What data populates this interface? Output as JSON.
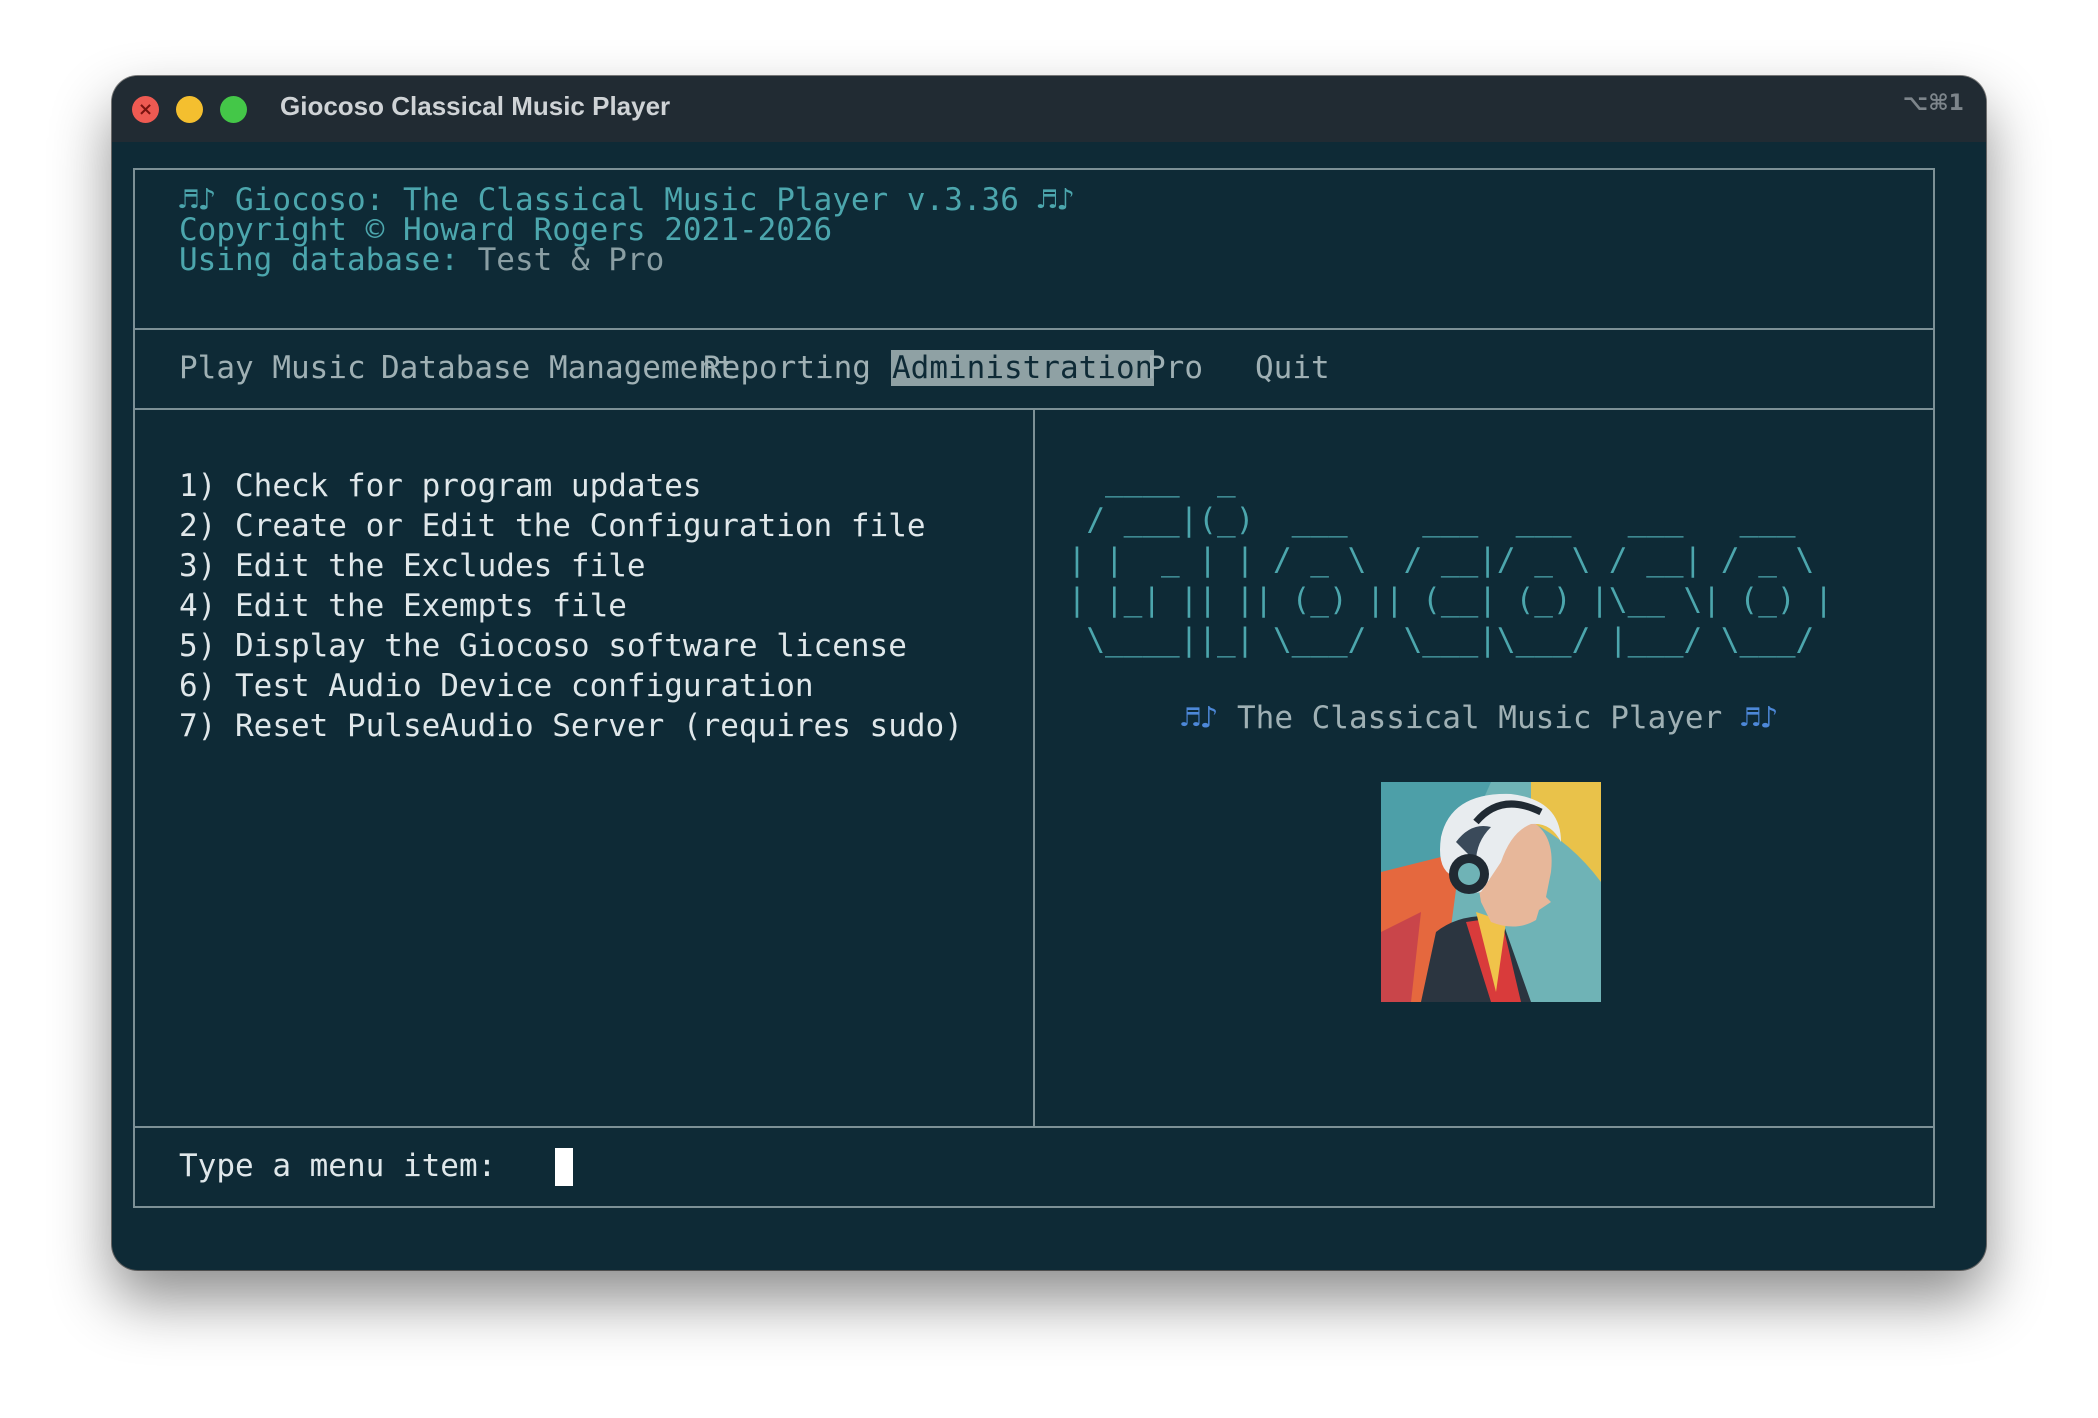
{
  "window": {
    "title": "Giocoso Classical Music Player",
    "shortcut": "⌥⌘1",
    "close_glyph": "×"
  },
  "header": {
    "notes_left": "♬♪",
    "title_line": " Giocoso: The Classical Music Player v.3.36 ",
    "notes_right": "♬♪",
    "copyright": "Copyright © Howard Rogers 2021-2026",
    "db_label": "Using database: ",
    "db_name": "Test & Pro"
  },
  "menu": {
    "items": [
      "Play Music",
      "Database Management",
      "Reporting",
      "Administration",
      "Pro",
      "Quit"
    ],
    "active": "Administration"
  },
  "options": [
    "1) Check for program updates",
    "2) Create or Edit the Configuration file",
    "3) Edit the Excludes file",
    "4) Edit the Exempts file",
    "5) Display the Giocoso software license",
    "6) Test Audio Device configuration",
    "7) Reset PulseAudio Server (requires sudo)"
  ],
  "logo": {
    "ascii": "   ____  _\n  / ___|(_)  ___    ___  ___   ___   ___\n | |  _ | | / _ \\  / __|/ _ \\ / __| / _ \\\n | |_| || || (_) || (__| (_) |\\__ \\| (_) |\n  \\____||_| \\___/  \\___|\\___/ |___/ \\___/",
    "tagline_notes_left": "♬♪",
    "tagline": " The Classical Music Player ",
    "tagline_notes_right": "♬♪"
  },
  "prompt": {
    "label": "Type a menu item:"
  },
  "colors": {
    "background": "#0e2a36",
    "accent": "#4ca6ad",
    "highlight": "#8fa1a4",
    "note_blue": "#4d88d8"
  }
}
